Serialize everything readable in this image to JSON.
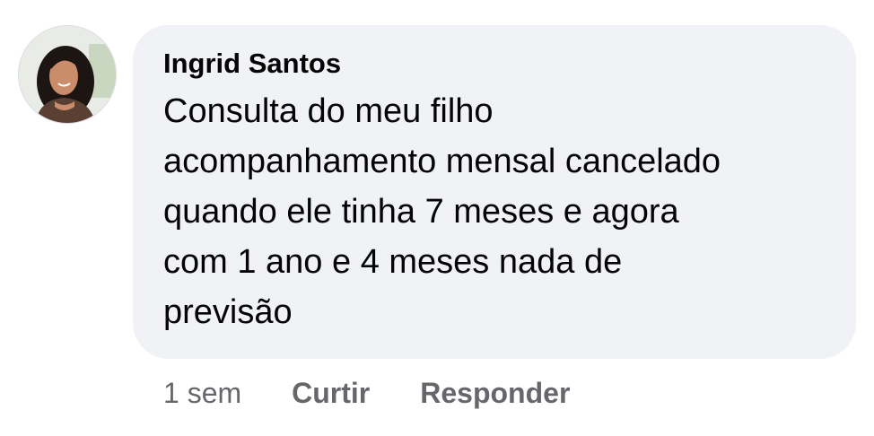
{
  "comment": {
    "author": "Ingrid Santos",
    "text": "Consulta do meu filho\nacompanhamento mensal cancelado\nquando ele tinha 7 meses e agora\ncom 1 ano e 4 meses nada de\nprevisão",
    "timestamp": "1 sem",
    "like_label": "Curtir",
    "reply_label": "Responder"
  },
  "colors": {
    "bubble_background": "#f0f2f5",
    "primary_text": "#050505",
    "secondary_text": "#65676b"
  },
  "icons": {
    "avatar": "profile-photo"
  }
}
